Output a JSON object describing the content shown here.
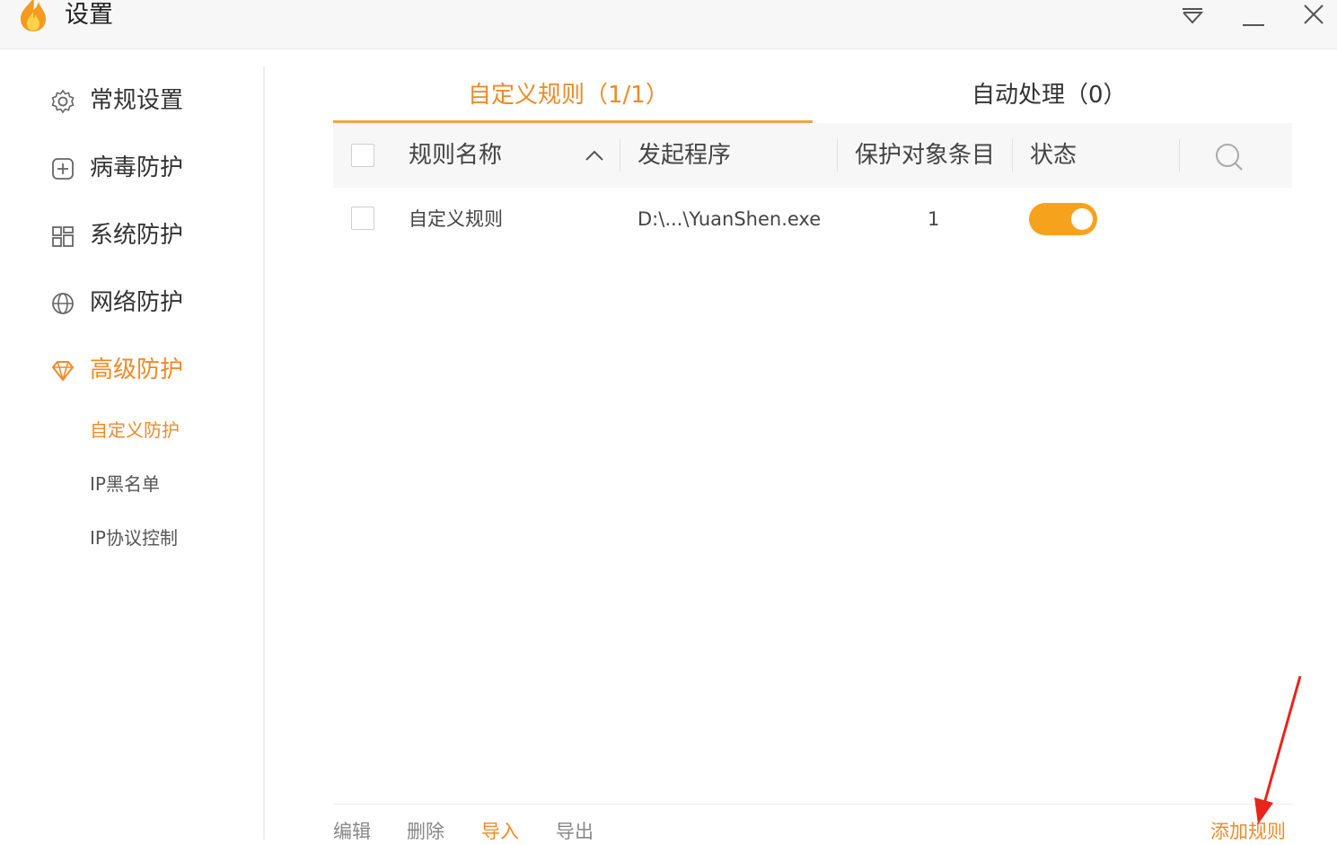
{
  "window": {
    "title": "设置"
  },
  "sidebar": {
    "items": [
      {
        "label": "常规设置",
        "icon": "gear-icon"
      },
      {
        "label": "病毒防护",
        "icon": "plus-square-icon"
      },
      {
        "label": "系统防护",
        "icon": "grid-icon"
      },
      {
        "label": "网络防护",
        "icon": "globe-icon"
      },
      {
        "label": "高级防护",
        "icon": "diamond-icon"
      }
    ],
    "sub_items": [
      {
        "label": "自定义防护"
      },
      {
        "label": "IP黑名单"
      },
      {
        "label": "IP协议控制"
      }
    ]
  },
  "tabs": [
    {
      "label": "自定义规则（1/1）"
    },
    {
      "label": "自动处理（0）"
    }
  ],
  "table": {
    "columns": [
      "规则名称",
      "发起程序",
      "保护对象条目",
      "状态"
    ],
    "rows": [
      {
        "name": "自定义规则",
        "program": "D:\\...\\YuanShen.exe",
        "count": "1",
        "enabled": true
      }
    ]
  },
  "footer": {
    "edit": "编辑",
    "delete": "删除",
    "import": "导入",
    "export": "导出",
    "add_rule": "添加规则"
  },
  "colors": {
    "accent": "#f08a24",
    "toggle_on": "#f7a21d",
    "annotation_arrow": "#e8251b"
  }
}
